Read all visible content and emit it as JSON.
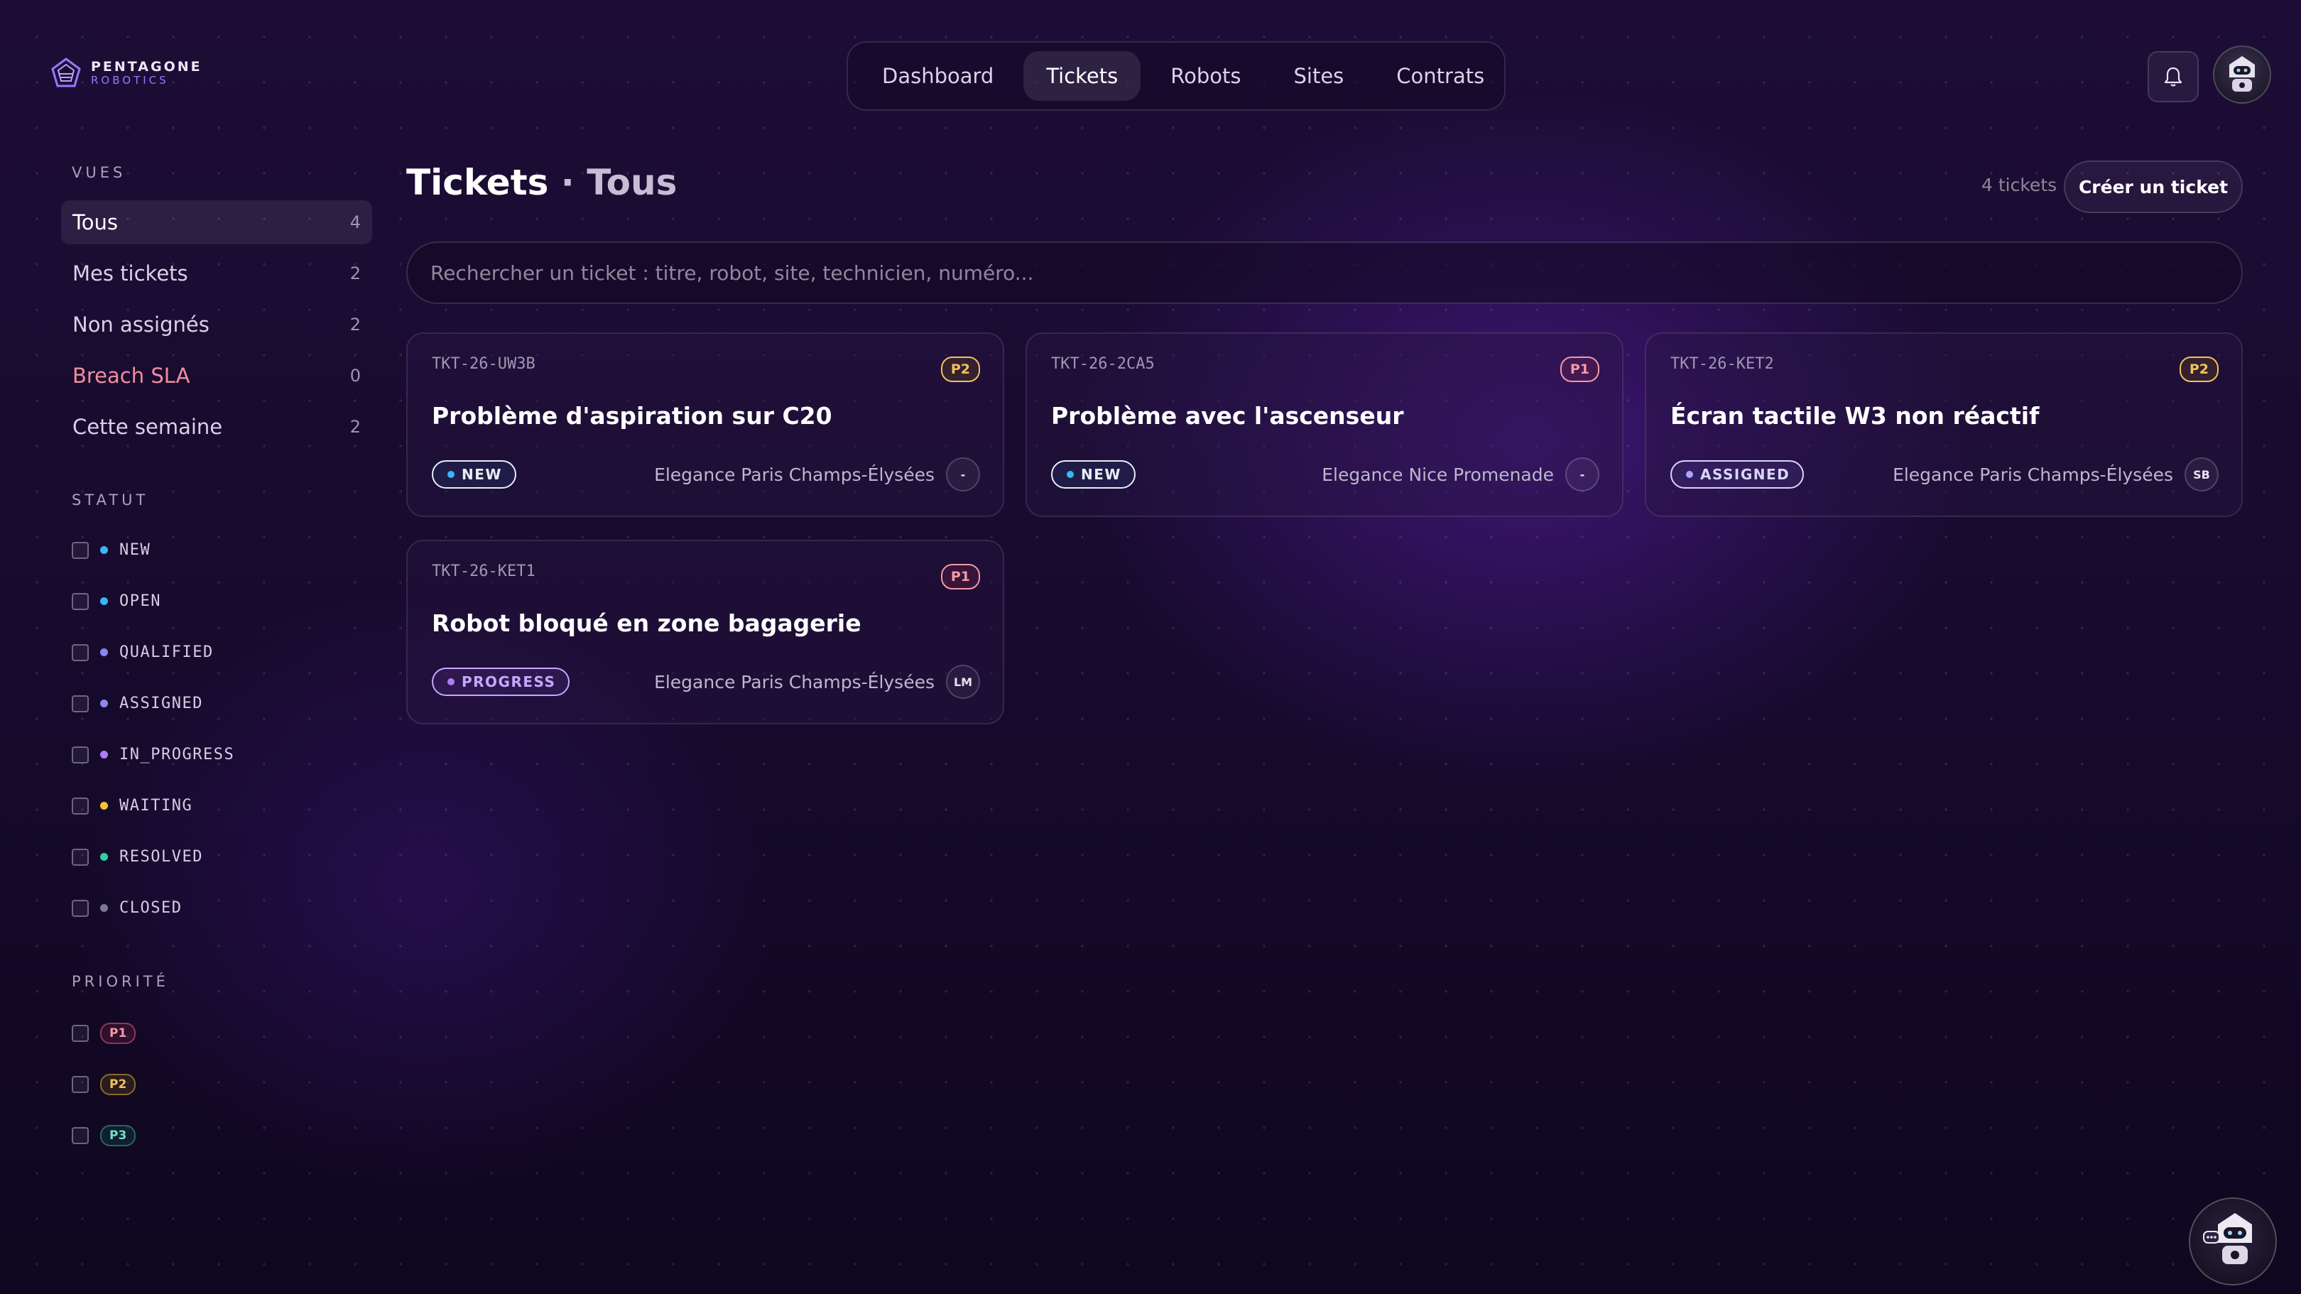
{
  "brand": {
    "line1": "PENTAGONE",
    "line2": "ROBOTICS"
  },
  "nav": {
    "tabs": [
      "Dashboard",
      "Tickets",
      "Robots",
      "Sites",
      "Contrats"
    ],
    "active": "Tickets"
  },
  "sidebar": {
    "views_heading": "VUES",
    "views": [
      {
        "label": "Tous",
        "count": "4",
        "active": true
      },
      {
        "label": "Mes tickets",
        "count": "2"
      },
      {
        "label": "Non assignés",
        "count": "2"
      },
      {
        "label": "Breach SLA",
        "count": "0",
        "alert": true
      },
      {
        "label": "Cette semaine",
        "count": "2"
      }
    ],
    "status_heading": "STATUT",
    "statuses": [
      {
        "label": "NEW",
        "color": "#38b6f5"
      },
      {
        "label": "OPEN",
        "color": "#38b6f5"
      },
      {
        "label": "QUALIFIED",
        "color": "#8b87f0"
      },
      {
        "label": "ASSIGNED",
        "color": "#8b87f0"
      },
      {
        "label": "IN_PROGRESS",
        "color": "#b07cf6"
      },
      {
        "label": "WAITING",
        "color": "#f3c431"
      },
      {
        "label": "RESOLVED",
        "color": "#2fd1a3"
      },
      {
        "label": "CLOSED",
        "color": "#7c7890"
      }
    ],
    "priority_heading": "PRIORITÉ",
    "priorities": [
      "P1",
      "P2",
      "P3"
    ]
  },
  "main": {
    "title": "Tickets",
    "separator": " · ",
    "subtitle": "Tous",
    "count_label": "4 tickets",
    "create_button": "Créer un ticket",
    "search_placeholder": "Rechercher un ticket : titre, robot, site, technicien, numéro..."
  },
  "tickets": [
    {
      "id": "TKT-26-UW3B",
      "priority": "P2",
      "title": "Problème d'aspiration sur C20",
      "status": "NEW",
      "site": "Elegance Paris Champs-Élysées",
      "tech": "-"
    },
    {
      "id": "TKT-26-2CA5",
      "priority": "P1",
      "title": "Problème avec l'ascenseur",
      "status": "NEW",
      "site": "Elegance Nice Promenade",
      "tech": "-"
    },
    {
      "id": "TKT-26-KET2",
      "priority": "P2",
      "title": "Écran tactile W3 non réactif",
      "status": "ASSIGNED",
      "site": "Elegance Paris Champs-Élysées",
      "tech": "SB"
    },
    {
      "id": "TKT-26-KET1",
      "priority": "P1",
      "title": "Robot bloqué en zone bagagerie",
      "status": "PROGRESS",
      "site": "Elegance Paris Champs-Élysées",
      "tech": "LM"
    }
  ],
  "colors": {
    "accent": "#8f7bff",
    "background": "#1a0c32",
    "sla_alert": "#ef8f9c"
  }
}
